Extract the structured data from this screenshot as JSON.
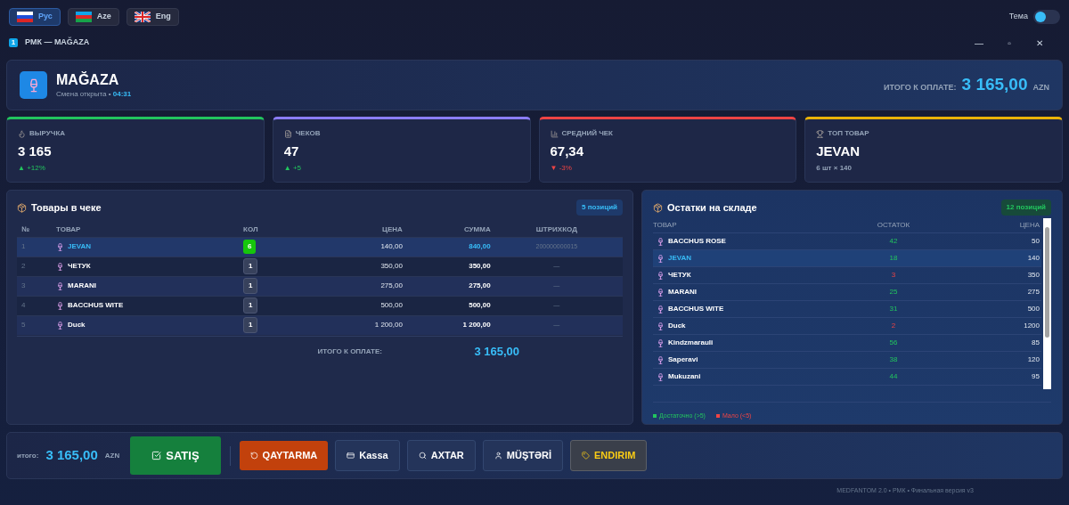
{
  "languages": [
    {
      "label": "Рус",
      "kind": "ru",
      "selected": true
    },
    {
      "label": "Aze",
      "kind": "az",
      "selected": false
    },
    {
      "label": "Eng",
      "kind": "gb",
      "selected": false
    }
  ],
  "theme": {
    "label": "Тема",
    "on": false
  },
  "window": {
    "badge": "1",
    "title": "РМК — MAĞAZA",
    "controls": [
      "—",
      "▫",
      "✕"
    ]
  },
  "header": {
    "title": "MAĞAZA",
    "shift": "Смена открыта",
    "separator": "•",
    "time": "04:31",
    "total_label": "ИТОГО К ОПЛАТЕ:",
    "total": "3 165,00",
    "currency": "AZN"
  },
  "stats": [
    {
      "kind": "money",
      "label": "ВЫРУЧКА",
      "value": "3 165",
      "delta": {
        "arrow": "▲",
        "text": "+12%",
        "color": "#22c55e"
      },
      "color": "#22c55e"
    },
    {
      "kind": "receipt",
      "label": "ЧЕКОВ",
      "value": "47",
      "delta": {
        "arrow": "▲",
        "text": "+5",
        "color": "#22c55e"
      },
      "color": "#8b7cf6"
    },
    {
      "kind": "chart",
      "label": "СРЕДНИЙ ЧЕК",
      "value": "67,34",
      "delta": {
        "arrow": "▼",
        "text": "-3%",
        "color": "#ef4444"
      },
      "color": "#ef4444"
    },
    {
      "kind": "trophy",
      "label": "ТОП ТОВАР",
      "value": "JEVAN",
      "note": "6 шт × 140",
      "color": "#eab308"
    }
  ],
  "receipt": {
    "title": "Товары в чеке",
    "count": "5 позиций",
    "columns": [
      "№",
      "ТОВАР",
      "КОЛ",
      "ЦЕНА",
      "СУММА",
      "ШТРИХКОД"
    ],
    "rows": [
      {
        "n": "1",
        "name": "JEVAN",
        "qty": "6",
        "price": "140,00",
        "sum": "840,00",
        "barcode": "200000000015",
        "selected": true
      },
      {
        "n": "2",
        "name": "ЧЕТУК",
        "qty": "1",
        "price": "350,00",
        "sum": "350,00",
        "barcode": "—",
        "selected": false
      },
      {
        "n": "3",
        "name": "MARANI",
        "qty": "1",
        "price": "275,00",
        "sum": "275,00",
        "barcode": "—",
        "selected": false
      },
      {
        "n": "4",
        "name": "BACCHUS WITE",
        "qty": "1",
        "price": "500,00",
        "sum": "500,00",
        "barcode": "—",
        "selected": false
      },
      {
        "n": "5",
        "name": "Duck",
        "qty": "1",
        "price": "1 200,00",
        "sum": "1 200,00",
        "barcode": "—",
        "selected": false
      }
    ],
    "total_label": "ИТОГО К ОПЛАТЕ:",
    "total": "3 165,00"
  },
  "stock": {
    "title": "Остатки на складе",
    "count": "12 позиций",
    "columns": [
      "ТОВАР",
      "ОСТАТОК",
      "ЦЕНА"
    ],
    "rows": [
      {
        "name": "BACCHUS ROSE",
        "qty": "42",
        "price": "50",
        "low": false,
        "selected": false
      },
      {
        "name": "JEVAN",
        "qty": "18",
        "price": "140",
        "low": false,
        "selected": true
      },
      {
        "name": "ЧЕТУК",
        "qty": "3",
        "price": "350",
        "low": true,
        "selected": false
      },
      {
        "name": "MARANI",
        "qty": "25",
        "price": "275",
        "low": false,
        "selected": false
      },
      {
        "name": "BACCHUS WITE",
        "qty": "31",
        "price": "500",
        "low": false,
        "selected": false
      },
      {
        "name": "Duck",
        "qty": "2",
        "price": "1200",
        "low": true,
        "selected": false
      },
      {
        "name": "Kindzmarauli",
        "qty": "56",
        "price": "85",
        "low": false,
        "selected": false
      },
      {
        "name": "Saperavi",
        "qty": "38",
        "price": "120",
        "low": false,
        "selected": false
      },
      {
        "name": "Mukuzani",
        "qty": "44",
        "price": "95",
        "low": false,
        "selected": false
      }
    ],
    "legend": [
      {
        "label": "Достаточно (>5)",
        "color": "#22c55e"
      },
      {
        "label": "Мало (<5)",
        "color": "#ef4444"
      }
    ]
  },
  "bottom": {
    "total_label": "итого:",
    "total": "3 165,00",
    "currency": "AZN",
    "actions": [
      {
        "kind": "sale",
        "label": "SATIŞ"
      },
      {
        "kind": "return",
        "label": "QAYTARMA"
      },
      {
        "kind": "cash",
        "label": "Kassa"
      },
      {
        "kind": "search",
        "label": "AXTAR"
      },
      {
        "kind": "customer",
        "label": "MÜŞTƏRİ"
      },
      {
        "kind": "discount",
        "label": "ENDIRIM"
      }
    ]
  },
  "footer": "MEDFANTOM 2.0 • РМК • Финальная версия v3"
}
